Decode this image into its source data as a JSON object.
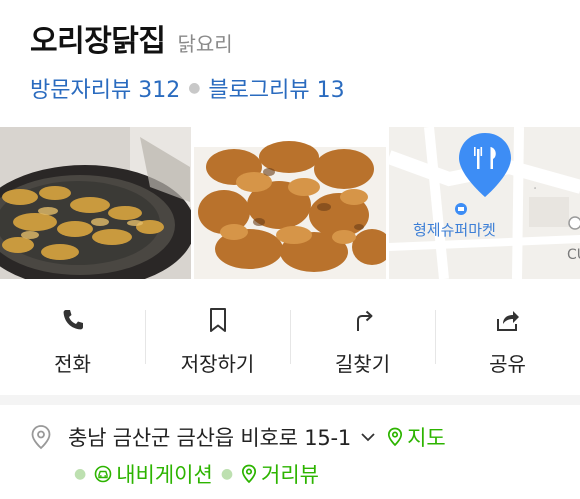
{
  "place": {
    "name": "오리장닭집",
    "category": "닭요리",
    "visitor_reviews": "방문자리뷰 312",
    "blog_reviews": "블로그리뷰 13"
  },
  "photos": [
    {
      "icon": "fryer-photo"
    },
    {
      "icon": "fried-chicken-photo"
    },
    {
      "icon": "map-thumbnail",
      "map_label": "형제슈퍼마켓",
      "side_text": "CU"
    }
  ],
  "actions": [
    {
      "label": "전화",
      "icon": "phone-icon"
    },
    {
      "label": "저장하기",
      "icon": "bookmark-icon"
    },
    {
      "label": "길찾기",
      "icon": "directions-icon"
    },
    {
      "label": "공유",
      "icon": "share-icon"
    }
  ],
  "address": {
    "text": "충남 금산군 금산읍 비호로 15-1",
    "map_link": "지도",
    "navigation_link": "내비게이션",
    "street_view_link": "거리뷰"
  },
  "colors": {
    "link_blue": "#2a6bbf",
    "accent_green": "#2db400",
    "map_pin_blue": "#3d8df5"
  }
}
